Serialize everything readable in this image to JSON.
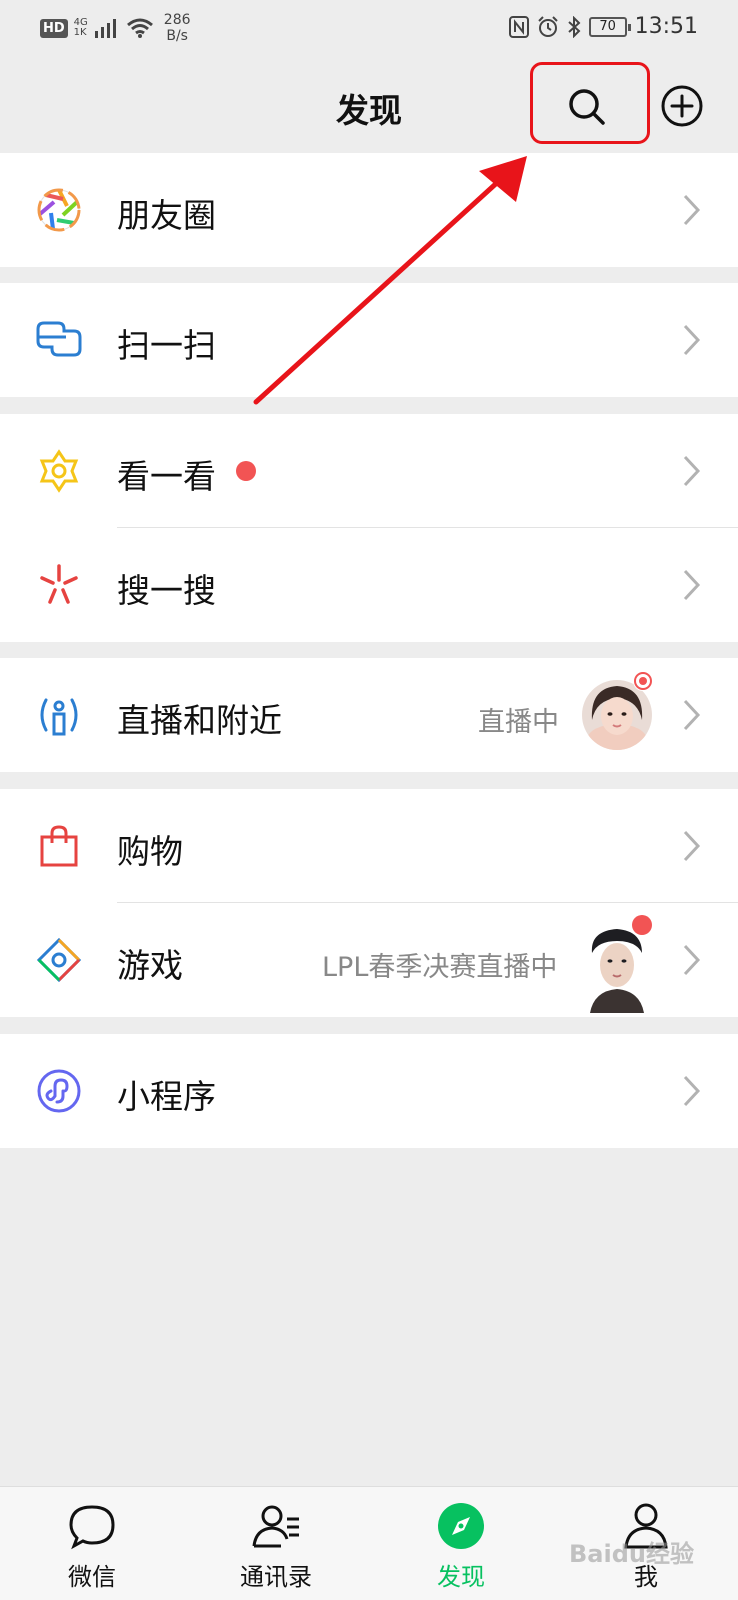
{
  "status_bar": {
    "hd": "HD",
    "network_top": "4G",
    "network_bottom": "1K",
    "speed_value": "286",
    "speed_unit": "B/s",
    "battery": "70",
    "time": "13:51"
  },
  "header": {
    "title": "发现",
    "highlight_color": "#e8141a"
  },
  "menu": {
    "moments": {
      "label": "朋友圈",
      "icon": "moments-aperture-icon"
    },
    "scan": {
      "label": "扫一扫",
      "icon": "scan-icon"
    },
    "top_stories": {
      "label": "看一看",
      "icon": "top-stories-icon",
      "badge_color": "#f25454"
    },
    "search": {
      "label": "搜一搜",
      "icon": "search-sparkle-icon"
    },
    "live_nearby": {
      "label": "直播和附近",
      "icon": "live-nearby-icon",
      "status": "直播中"
    },
    "shopping": {
      "label": "购物",
      "icon": "shopping-bag-icon"
    },
    "games": {
      "label": "游戏",
      "icon": "games-icon",
      "status": "LPL春季决赛直播中"
    },
    "mini_programs": {
      "label": "小程序",
      "icon": "mini-program-icon"
    }
  },
  "tabs": [
    {
      "label": "微信",
      "icon": "chat-bubble-icon"
    },
    {
      "label": "通讯录",
      "icon": "contacts-icon"
    },
    {
      "label": "发现",
      "icon": "compass-icon",
      "active": true,
      "color": "#07c160"
    },
    {
      "label": "我",
      "icon": "person-icon"
    }
  ],
  "watermark": "Baidu经验"
}
